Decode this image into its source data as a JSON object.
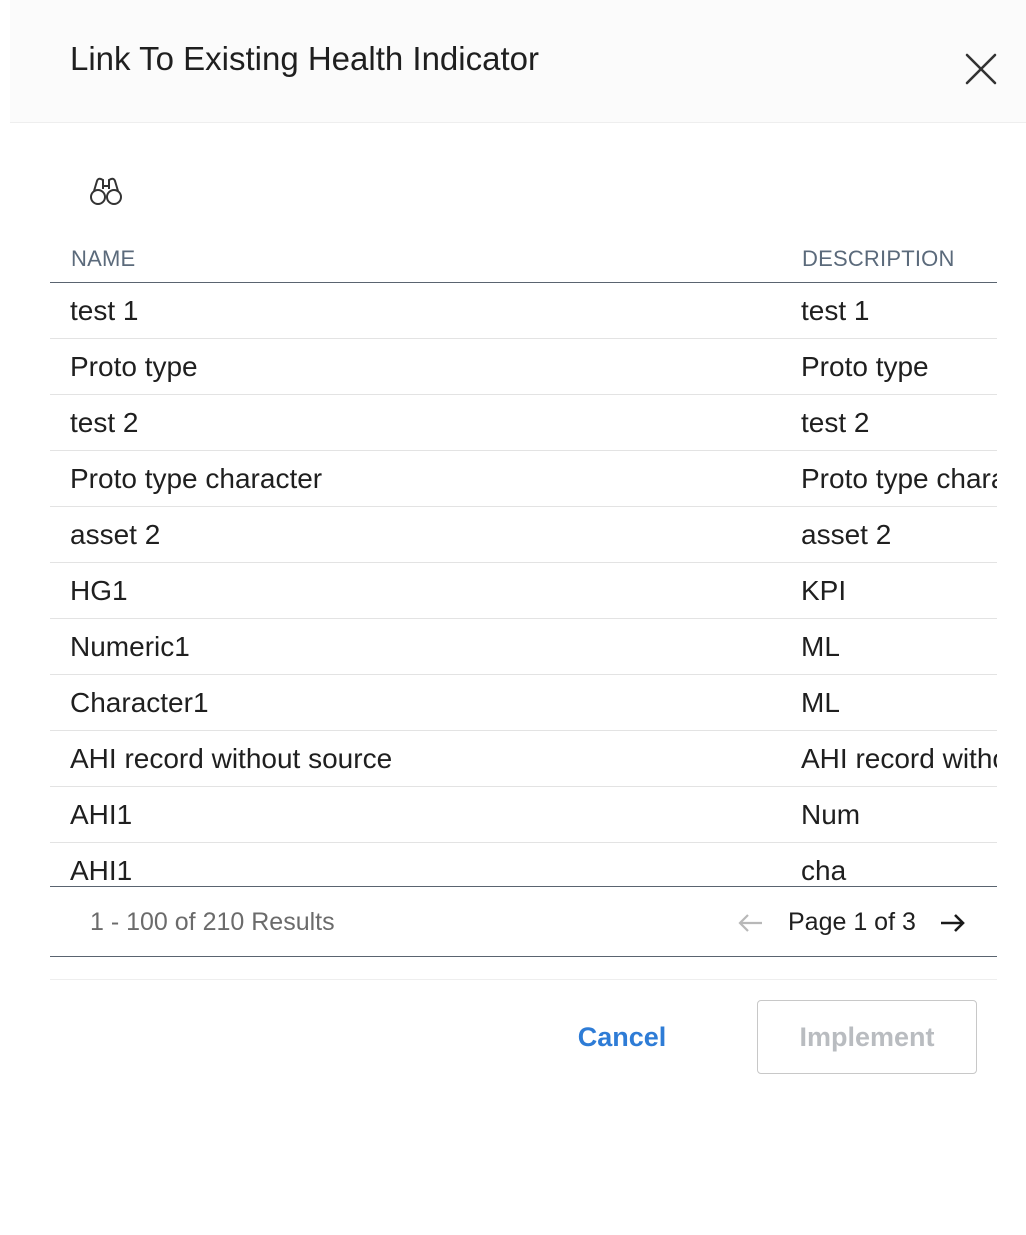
{
  "dialog": {
    "title": "Link To Existing Health Indicator",
    "close_icon": "close-icon",
    "search_icon": "binoculars-icon"
  },
  "table": {
    "columns": [
      "NAME",
      "DESCRIPTION"
    ],
    "rows": [
      {
        "name": "test 1",
        "description": "test 1"
      },
      {
        "name": "Proto type",
        "description": "Proto type"
      },
      {
        "name": "test 2",
        "description": "test 2"
      },
      {
        "name": "Proto type character",
        "description": "Proto type character"
      },
      {
        "name": "asset 2",
        "description": "asset 2"
      },
      {
        "name": "HG1",
        "description": "KPI"
      },
      {
        "name": "Numeric1",
        "description": "ML"
      },
      {
        "name": "Character1",
        "description": "ML"
      },
      {
        "name": "AHI record without source",
        "description": "AHI record without source"
      },
      {
        "name": "AHI1",
        "description": "Num"
      },
      {
        "name": "AHI1",
        "description": "cha"
      }
    ]
  },
  "pagination": {
    "results_text": "1 - 100 of 210 Results",
    "page_text": "Page 1 of 3",
    "prev_icon": "arrow-left-icon",
    "next_icon": "arrow-right-icon"
  },
  "actions": {
    "cancel_label": "Cancel",
    "implement_label": "Implement",
    "implement_disabled": true
  },
  "colors": {
    "accent": "#2e7cd6",
    "header_bg": "#fbfbfb",
    "column_header_text": "#5b6a7b",
    "disabled_text": "#b9bcc0"
  }
}
